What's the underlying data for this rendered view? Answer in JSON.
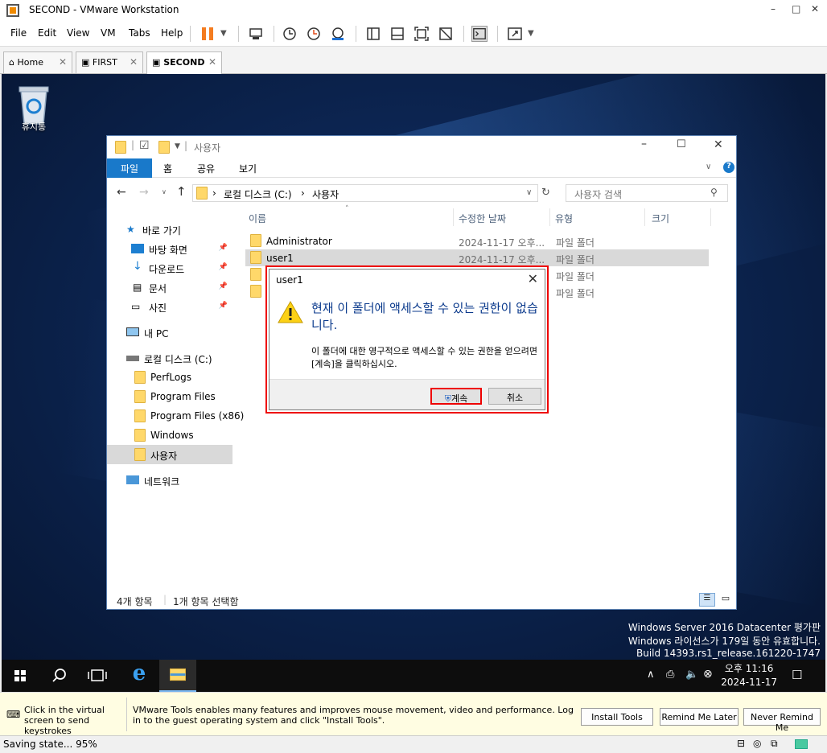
{
  "window": {
    "title": "SECOND - VMware Workstation"
  },
  "menu": [
    "File",
    "Edit",
    "View",
    "VM",
    "Tabs",
    "Help"
  ],
  "tabs": [
    {
      "label": "Home"
    },
    {
      "label": "FIRST"
    },
    {
      "label": "SECOND"
    }
  ],
  "desktop": {
    "recycle_label": "휴지통",
    "watermark": [
      "Windows Server 2016 Datacenter 평가판",
      "Windows 라이선스가 179일 동안 유효합니다.",
      "Build 14393.rs1_release.161220-1747"
    ]
  },
  "explorer": {
    "title": "사용자",
    "ribbon": [
      "파일",
      "홈",
      "공유",
      "보기"
    ],
    "breadcrumb": [
      "로컬 디스크 (C:)",
      "사용자"
    ],
    "search_placeholder": "사용자 검색",
    "nav": {
      "quick": "바로 가기",
      "desktop": "바탕 화면",
      "downloads": "다운로드",
      "documents": "문서",
      "pictures": "사진",
      "mypc": "내 PC",
      "localdisk": "로컬 디스크 (C:)",
      "perflogs": "PerfLogs",
      "programfiles": "Program Files",
      "programfiles86": "Program Files (x86)",
      "windows": "Windows",
      "users": "사용자",
      "network": "네트워크"
    },
    "columns": [
      "이름",
      "수정한 날짜",
      "유형",
      "크기"
    ],
    "rows": [
      {
        "name": "Administrator",
        "date": "2024-11-17 오후...",
        "type": "파일 폴더"
      },
      {
        "name": "user1",
        "date": "2024-11-17 오후...",
        "type": "파일 폴더"
      },
      {
        "name": "",
        "date": "",
        "type": "파일 폴더"
      },
      {
        "name": "",
        "date": "",
        "type": "파일 폴더"
      }
    ],
    "status_count": "4개 항목",
    "status_selected": "1개 항목 선택함"
  },
  "dialog": {
    "title": "user1",
    "main": "현재 이 폴더에 액세스할 수 있는 권한이 없습니다.",
    "sub": "이 폴더에 대한 영구적으로 액세스할 수 있는 권한을 얻으려면 [계속]을 클릭하십시오.",
    "continue": "계속",
    "cancel": "취소"
  },
  "taskbar": {
    "time": "오후 11:16",
    "date": "2024-11-17"
  },
  "tools": {
    "hint": "Click in the virtual screen to send keystrokes",
    "message": "VMware Tools enables many features and improves mouse movement, video and performance. Log in to the guest operating system and click \"Install Tools\".",
    "install": "Install Tools",
    "remind": "Remind Me Later",
    "never": "Never Remind Me"
  },
  "status": "Saving state... 95%"
}
